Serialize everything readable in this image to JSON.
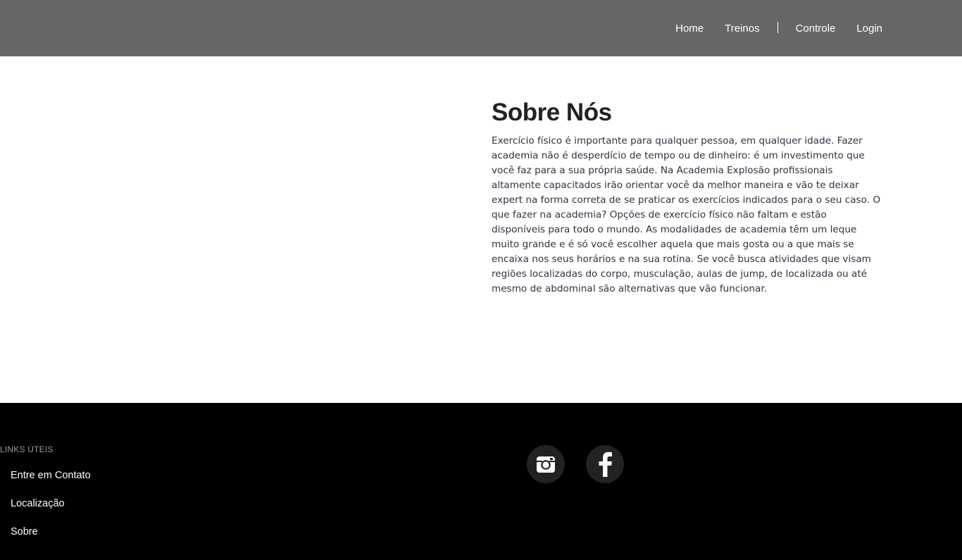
{
  "nav": {
    "items": [
      {
        "label": "Home"
      },
      {
        "label": "Treinos"
      },
      {
        "label": "Controle"
      },
      {
        "label": "Login"
      }
    ]
  },
  "about": {
    "title": "Sobre Nós",
    "text": "Exercício físico é importante para qualquer pessoa, em qualquer idade. Fazer academia não é desperdício de tempo ou de dinheiro: é um investimento que você faz para a sua própria saúde. Na Academia Explosão profissionais altamente capacitados irão orientar você da melhor maneira e vão te deixar expert na forma correta de se praticar os exercícios indicados para o seu caso. O que fazer na academia? Opções de exercício físico não faltam e estão disponíveis para todo o mundo. As modalidades de academia têm um leque muito grande e é só você escolher aquela que mais gosta ou a que mais se encaixa nos seus horários e na sua rotina. Se você busca atividades que visam regiões localizadas do corpo, musculação, aulas de jump, de localizada ou até mesmo de abdominal são alternativas que vão funcionar."
  },
  "footer": {
    "heading": "LINKS ÚTEIS",
    "links": [
      {
        "label": "Entre em Contato"
      },
      {
        "label": "Localização"
      },
      {
        "label": "Sobre"
      }
    ],
    "social": [
      {
        "icon": "instagram-icon"
      },
      {
        "icon": "facebook-icon"
      }
    ]
  },
  "colors": {
    "navbar_bg": "#666666",
    "footer_bg": "#000000",
    "social_circle": "#222222",
    "title_text": "#222222",
    "body_text": "#2b3340"
  }
}
